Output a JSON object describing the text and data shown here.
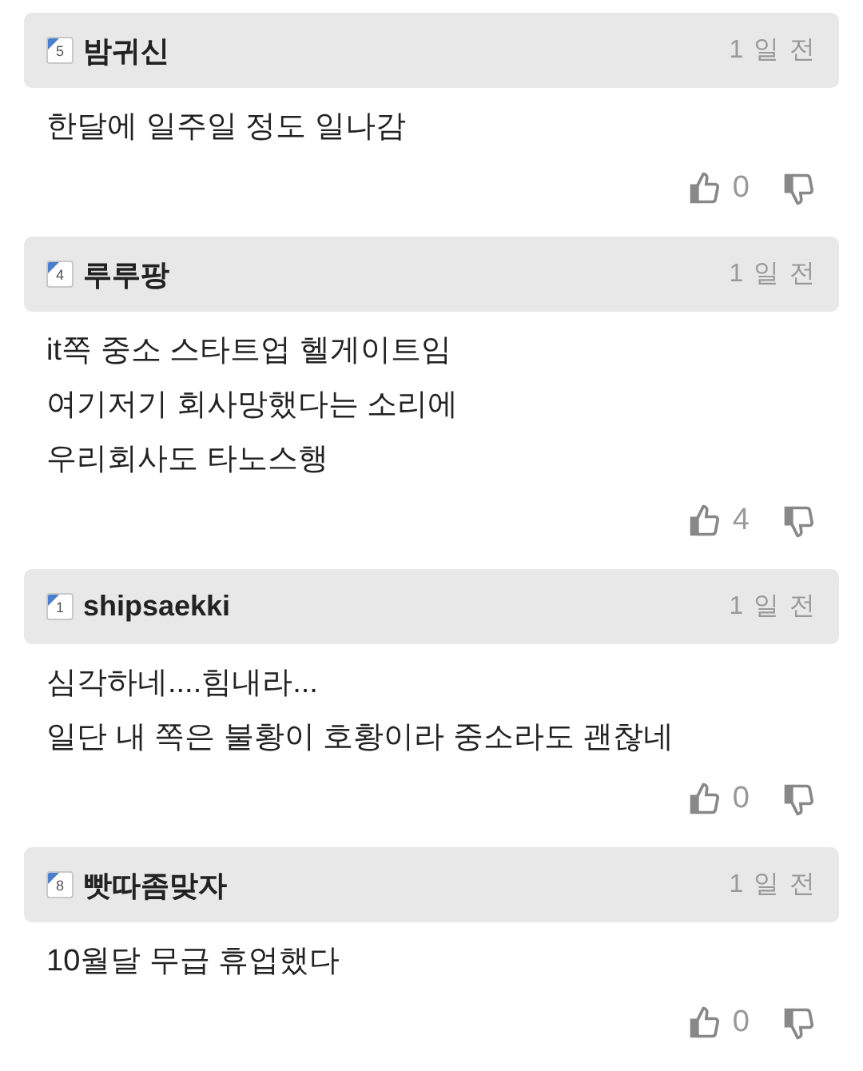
{
  "comments": [
    {
      "level": "5",
      "author": "밤귀신",
      "time": "1 일 전",
      "lines": [
        "한달에 일주일 정도 일나감"
      ],
      "likes": "0"
    },
    {
      "level": "4",
      "author": "루루팡",
      "time": "1 일 전",
      "lines": [
        "it쪽 중소 스타트업 헬게이트임",
        "여기저기 회사망했다는 소리에",
        "우리회사도 타노스행"
      ],
      "likes": "4"
    },
    {
      "level": "1",
      "author": "shipsaekki",
      "time": "1 일 전",
      "lines": [
        "심각하네....힘내라...",
        "일단 내 쪽은 불황이 호황이라 중소라도 괜찮네"
      ],
      "likes": "0"
    },
    {
      "level": "8",
      "author": "빳따좀맞자",
      "time": "1 일 전",
      "lines": [
        "10월달 무급 휴업했다"
      ],
      "likes": "0"
    }
  ]
}
